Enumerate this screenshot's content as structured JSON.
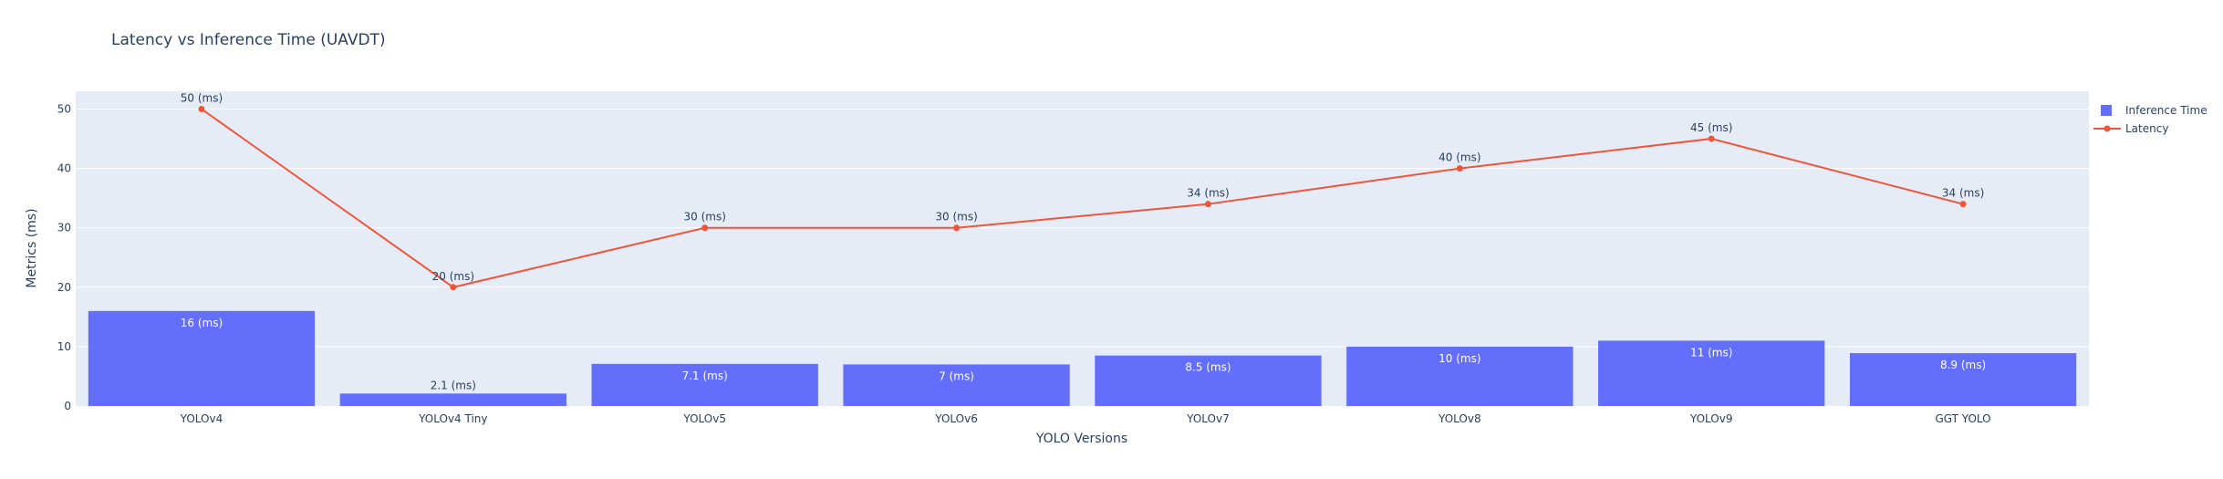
{
  "chart_data": {
    "type": "bar",
    "title": "Latency vs Inference Time (UAVDT)",
    "xlabel": "YOLO Versions",
    "ylabel": "Metrics (ms)",
    "ylim": [
      0,
      53
    ],
    "yticks": [
      0,
      10,
      20,
      30,
      40,
      50
    ],
    "grid": true,
    "legend_position": "right",
    "categories": [
      "YOLOv4",
      "YOLOv4 Tiny",
      "YOLOv5",
      "YOLOv6",
      "YOLOv7",
      "YOLOv8",
      "YOLOv9",
      "GGT YOLO"
    ],
    "series": [
      {
        "name": "Inference Time",
        "type": "bar",
        "color": "#636efa",
        "values": [
          16,
          2.1,
          7.1,
          7,
          8.5,
          10,
          11,
          8.9
        ],
        "labels": [
          "16 (ms)",
          "2.1 (ms)",
          "7.1 (ms)",
          "7 (ms)",
          "8.5 (ms)",
          "10 (ms)",
          "11 (ms)",
          "8.9 (ms)"
        ]
      },
      {
        "name": "Latency",
        "type": "line",
        "color": "#ef553b",
        "values": [
          50,
          20,
          30,
          30,
          34,
          40,
          45,
          34
        ],
        "labels": [
          "50 (ms)",
          "20 (ms)",
          "30 (ms)",
          "30 (ms)",
          "34 (ms)",
          "40 (ms)",
          "45 (ms)",
          "34 (ms)"
        ]
      }
    ]
  }
}
